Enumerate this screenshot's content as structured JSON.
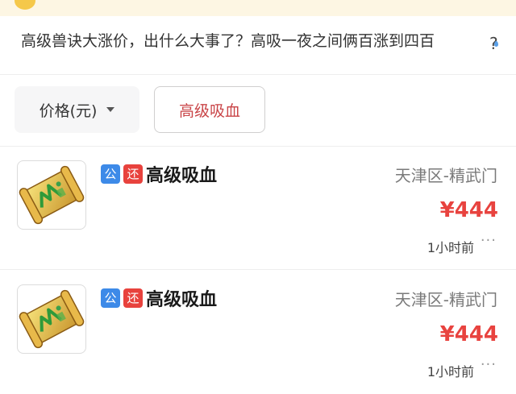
{
  "headline": {
    "text": "高级兽诀大涨价，出什么大事了？高吸一夜之间俩百涨到四百",
    "trailing_mark": "?"
  },
  "filters": {
    "price_label": "价格(元)",
    "keyword_chip": "高级吸血"
  },
  "listings": [
    {
      "badge_public": "公",
      "badge_return": "还",
      "name": "高级吸血",
      "server": "天津区-精武门",
      "price": "¥444",
      "time": "1小时前",
      "more": "···"
    },
    {
      "badge_public": "公",
      "badge_return": "还",
      "name": "高级吸血",
      "server": "天津区-精武门",
      "price": "¥444",
      "time": "1小时前",
      "more": "···"
    }
  ],
  "colors": {
    "accent_red": "#e8433f",
    "chip_text": "#c94447",
    "badge_blue": "#3d8ae8",
    "badge_red": "#e8423d",
    "banner_bg": "#fdf6e3"
  },
  "icons": {
    "item": "skill-scroll-icon",
    "dropdown": "caret-down-icon",
    "more": "more-options-icon"
  }
}
